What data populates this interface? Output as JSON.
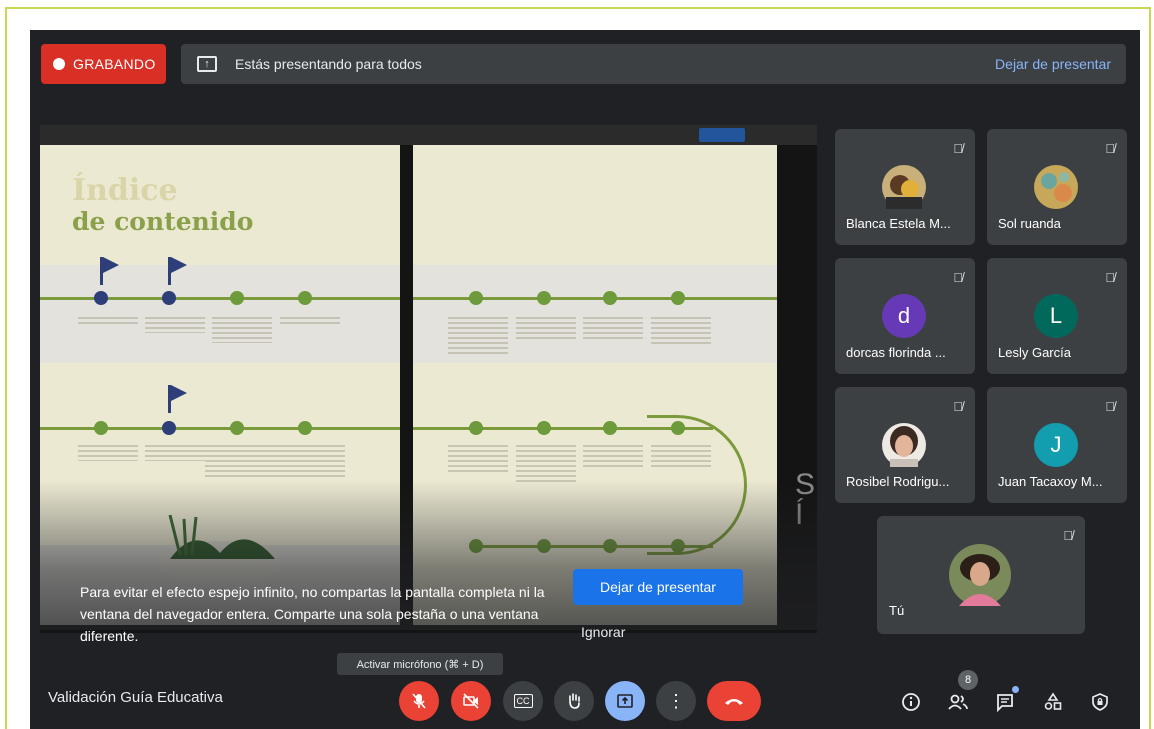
{
  "recording": {
    "label": "GRABANDO"
  },
  "present_bar": {
    "message": "Estás presentando para todos",
    "stop_label": "Dejar de presentar"
  },
  "shared_doc": {
    "title_line1": "Índice",
    "title_line2": "de contenido"
  },
  "overlay": {
    "warning": "Para evitar el efecto espejo infinito, no compartas la pantalla completa ni la ventana del navegador entera. Comparte una sola pestaña o una ventana diferente.",
    "stop_button": "Dejar de presentar",
    "ignore_button": "Ignorar"
  },
  "participants": [
    {
      "name": "Blanca Estela M...",
      "avatar_type": "photo",
      "muted": true
    },
    {
      "name": "Sol ruanda",
      "avatar_type": "photo",
      "muted": true
    },
    {
      "name": "dorcas florinda ...",
      "avatar_type": "letter",
      "initial": "d",
      "color": "#6639b7",
      "muted": true
    },
    {
      "name": "Lesly García",
      "avatar_type": "letter",
      "initial": "L",
      "color": "#00695c",
      "muted": true
    },
    {
      "name": "Rosibel Rodrigu...",
      "avatar_type": "photo",
      "muted": true
    },
    {
      "name": "Juan Tacaxoy M...",
      "avatar_type": "letter",
      "initial": "J",
      "color": "#129eaf",
      "muted": true
    },
    {
      "name": "Tú",
      "avatar_type": "photo",
      "muted": true
    }
  ],
  "meeting": {
    "title": "Validación Guía Educativa"
  },
  "tooltip": {
    "text": "Activar micrófono (⌘ + D)"
  },
  "controls": {
    "mic": {
      "icon": "mic-off-icon",
      "state": "off"
    },
    "camera": {
      "icon": "camera-off-icon",
      "state": "off"
    },
    "captions": {
      "icon": "captions-icon",
      "label": "CC"
    },
    "raise_hand": {
      "icon": "hand-icon"
    },
    "present": {
      "icon": "present-icon",
      "state": "active"
    },
    "more": {
      "icon": "more-vert-icon"
    },
    "hangup": {
      "icon": "hangup-icon"
    }
  },
  "right_controls": {
    "people_count": "8"
  },
  "colors": {
    "background": "#202124",
    "tile": "#3c4043",
    "record_red": "#d93025",
    "accent_blue": "#8ab4f8",
    "button_blue": "#1a73e8"
  }
}
